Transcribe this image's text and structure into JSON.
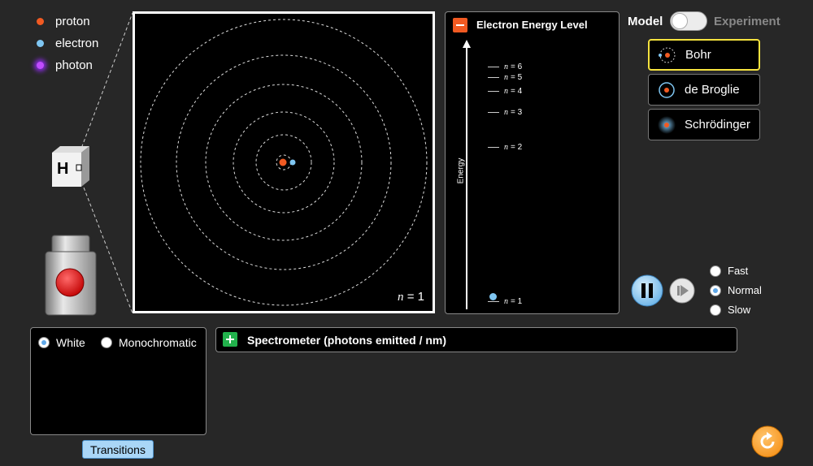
{
  "legend": {
    "items": [
      {
        "label": "proton",
        "color": "#f15a22"
      },
      {
        "label": "electron",
        "color": "#7fc6f2"
      },
      {
        "label": "photon",
        "color": "#c04cff"
      }
    ]
  },
  "gun": {
    "box_label": "H"
  },
  "atom_view": {
    "n_var": "n",
    "n_label": "= 1"
  },
  "energy_panel": {
    "title": "Electron Energy Level",
    "axis_label": "Energy",
    "levels": [
      {
        "var": "n",
        "text": "= 6"
      },
      {
        "var": "n",
        "text": "= 5"
      },
      {
        "var": "n",
        "text": "= 4"
      },
      {
        "var": "n",
        "text": "= 3"
      },
      {
        "var": "n",
        "text": "= 2"
      },
      {
        "var": "n",
        "text": "= 1"
      }
    ]
  },
  "mode_toggle": {
    "left_label": "Model",
    "right_label": "Experiment"
  },
  "models": [
    {
      "label": "Bohr",
      "selected": true
    },
    {
      "label": "de Broglie",
      "selected": false
    },
    {
      "label": "Schrödinger",
      "selected": false
    }
  ],
  "speed": {
    "options": [
      {
        "label": "Fast",
        "selected": false
      },
      {
        "label": "Normal",
        "selected": true
      },
      {
        "label": "Slow",
        "selected": false
      }
    ]
  },
  "light": {
    "white_label": "White",
    "mono_label": "Monochromatic",
    "selected": "White"
  },
  "spectrometer": {
    "title": "Spectrometer (photons emitted / nm)"
  },
  "transitions_label": "Transitions",
  "colors": {
    "accent_orange": "#f7941d",
    "play_blue": "#7fc6f2",
    "selected_border": "#f6e33f"
  }
}
